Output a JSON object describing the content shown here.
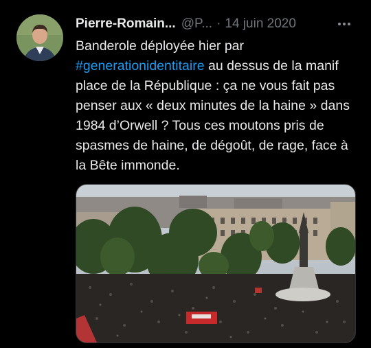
{
  "author": {
    "name": "Pierre-Romain...",
    "handle": "@P...",
    "separator": "·",
    "date": "14 juin 2020"
  },
  "tweet": {
    "line1": "Banderole déployée hier par",
    "hashtag": "#generationidentitaire",
    "rest": " au dessus de la manif place de la République : ça ne vous fait pas penser aux « deux minutes de la haine » dans 1984 d’Orwell ? Tous ces moutons pris de spasmes de haine, de dégoût, de rage, face à la Bête immonde."
  },
  "icons": {
    "avatar": "profile-photo",
    "more": "more-horizontal-icon"
  },
  "colors": {
    "background": "#000000",
    "text": "#e7e9ea",
    "muted": "#71767b",
    "link": "#1d9bf0"
  }
}
